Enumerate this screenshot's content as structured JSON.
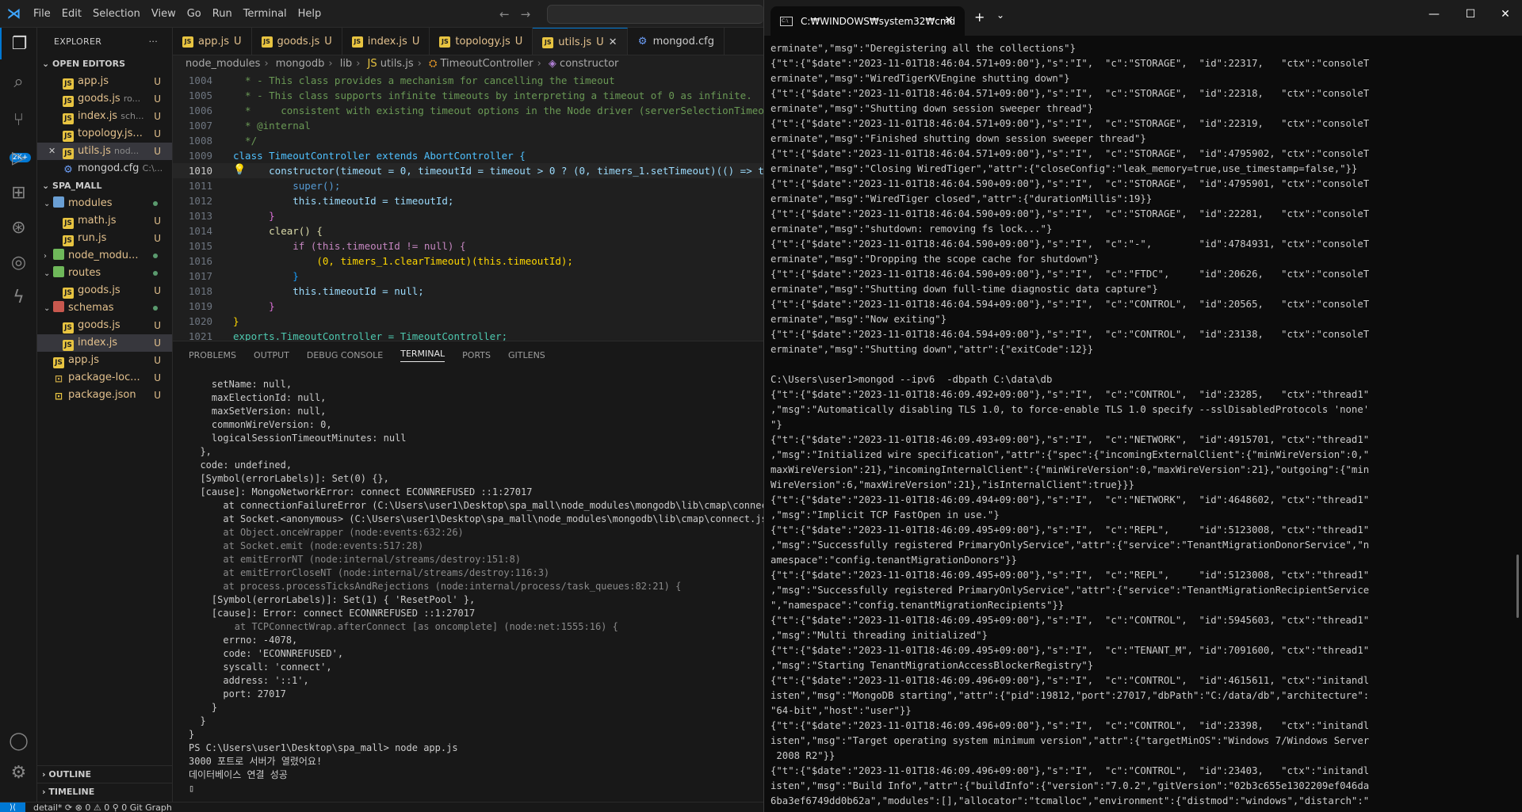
{
  "menu": [
    "File",
    "Edit",
    "Selection",
    "View",
    "Go",
    "Run",
    "Terminal",
    "Help"
  ],
  "activity_badge": "2K+",
  "explorer": {
    "title": "EXPLORER",
    "open_editors_label": "OPEN EDITORS",
    "open_editors": [
      {
        "name": "app.js",
        "desc": "",
        "badge": "U"
      },
      {
        "name": "goods.js",
        "desc": "ro...",
        "badge": "U"
      },
      {
        "name": "index.js",
        "desc": "sch...",
        "badge": "U"
      },
      {
        "name": "topology.js...",
        "desc": "",
        "badge": "U"
      },
      {
        "name": "utils.js",
        "desc": "nod...",
        "badge": "U"
      },
      {
        "name": "mongod.cfg",
        "desc": "C:\\...",
        "badge": ""
      }
    ],
    "project_label": "SPA_MALL",
    "tree": [
      {
        "name": "modules"
      },
      {
        "name": "math.js",
        "badge": "U"
      },
      {
        "name": "run.js",
        "badge": "U"
      },
      {
        "name": "node_modu..."
      },
      {
        "name": "routes"
      },
      {
        "name": "goods.js",
        "badge": "U"
      },
      {
        "name": "schemas"
      },
      {
        "name": "goods.js",
        "badge": "U"
      },
      {
        "name": "index.js",
        "badge": "U"
      },
      {
        "name": "app.js",
        "badge": "U"
      },
      {
        "name": "package-loc...",
        "badge": "U"
      },
      {
        "name": "package.json",
        "badge": "U"
      }
    ],
    "outline_label": "OUTLINE",
    "timeline_label": "TIMELINE"
  },
  "tabs": [
    {
      "name": "app.js",
      "badge": "U"
    },
    {
      "name": "goods.js",
      "badge": "U"
    },
    {
      "name": "index.js",
      "badge": "U"
    },
    {
      "name": "topology.js",
      "badge": "U"
    },
    {
      "name": "utils.js",
      "badge": "U"
    },
    {
      "name": "mongod.cfg",
      "badge": ""
    }
  ],
  "breadcrumb": [
    "node_modules",
    "mongodb",
    "lib",
    "utils.js",
    "TimeoutController",
    "constructor"
  ],
  "code_lines": [
    {
      "n": "1004",
      "t": "  * - This class provides a mechanism for cancelling the timeout"
    },
    {
      "n": "1005",
      "t": "  * - This class supports infinite timeouts by interpreting a timeout of 0 as infinite."
    },
    {
      "n": "1006",
      "t": "  *     consistent with existing timeout options in the Node driver (serverSelectionTimeo"
    },
    {
      "n": "1007",
      "t": "  * @internal"
    },
    {
      "n": "1008",
      "t": "  */"
    },
    {
      "n": "1009",
      "t": "class TimeoutController extends AbortController {"
    },
    {
      "n": "1010",
      "t": "      constructor(timeout = 0, timeoutId = timeout > 0 ? (0, timers_1.setTimeout)(() => t"
    },
    {
      "n": "1011",
      "t": "          super();"
    },
    {
      "n": "1012",
      "t": "          this.timeoutId = timeoutId;"
    },
    {
      "n": "1013",
      "t": "      }"
    },
    {
      "n": "1014",
      "t": "      clear() {"
    },
    {
      "n": "1015",
      "t": "          if (this.timeoutId != null) {"
    },
    {
      "n": "1016",
      "t": "              (0, timers_1.clearTimeout)(this.timeoutId);"
    },
    {
      "n": "1017",
      "t": "          }"
    },
    {
      "n": "1018",
      "t": "          this.timeoutId = null;"
    },
    {
      "n": "1019",
      "t": "      }"
    },
    {
      "n": "1020",
      "t": "}"
    },
    {
      "n": "1021",
      "t": "exports.TimeoutController = TimeoutController;"
    }
  ],
  "panel_tabs": [
    "PROBLEMS",
    "OUTPUT",
    "DEBUG CONSOLE",
    "TERMINAL",
    "PORTS",
    "GITLENS"
  ],
  "terminal_lines": [
    "    setName: null,",
    "    maxElectionId: null,",
    "    maxSetVersion: null,",
    "    commonWireVersion: 0,",
    "    logicalSessionTimeoutMinutes: null",
    "  },",
    "  code: undefined,",
    "  [Symbol(errorLabels)]: Set(0) {},",
    "  [cause]: MongoNetworkError: connect ECONNREFUSED ::1:27017",
    "      at connectionFailureError (C:\\Users\\user1\\Desktop\\spa_mall\\node_modules\\mongodb\\lib\\cmap\\connect.",
    "      at Socket.<anonymous> (C:\\Users\\user1\\Desktop\\spa_mall\\node_modules\\mongodb\\lib\\cmap\\connect.js:2",
    "      at Object.onceWrapper (node:events:632:26)",
    "      at Socket.emit (node:events:517:28)",
    "      at emitErrorNT (node:internal/streams/destroy:151:8)",
    "      at emitErrorCloseNT (node:internal/streams/destroy:116:3)",
    "      at process.processTicksAndRejections (node:internal/process/task_queues:82:21) {",
    "    [Symbol(errorLabels)]: Set(1) { 'ResetPool' },",
    "    [cause]: Error: connect ECONNREFUSED ::1:27017",
    "        at TCPConnectWrap.afterConnect [as oncomplete] (node:net:1555:16) {",
    "      errno: -4078,",
    "      code: 'ECONNREFUSED',",
    "      syscall: 'connect',",
    "      address: '::1',",
    "      port: 27017",
    "    }",
    "  }",
    "}",
    "PS C:\\Users\\user1\\Desktop\\spa_mall> node app.js",
    "3000 포트로 서버가 열렸어요!",
    "데이터베이스 연결 성공",
    "▯"
  ],
  "status_text": "detail*  ⟳   ⊗ 0 ⚠ 0   ⚲ 0    Git Graph",
  "cmd": {
    "tab_title": "C:₩WINDOWS₩system32₩cmd",
    "lines": [
      "erminate\",\"msg\":\"Deregistering all the collections\"}",
      "{\"t\":{\"$date\":\"2023-11-01T18:46:04.571+09:00\"},\"s\":\"I\",  \"c\":\"STORAGE\",  \"id\":22317,   \"ctx\":\"consoleT",
      "erminate\",\"msg\":\"WiredTigerKVEngine shutting down\"}",
      "{\"t\":{\"$date\":\"2023-11-01T18:46:04.571+09:00\"},\"s\":\"I\",  \"c\":\"STORAGE\",  \"id\":22318,   \"ctx\":\"consoleT",
      "erminate\",\"msg\":\"Shutting down session sweeper thread\"}",
      "{\"t\":{\"$date\":\"2023-11-01T18:46:04.571+09:00\"},\"s\":\"I\",  \"c\":\"STORAGE\",  \"id\":22319,   \"ctx\":\"consoleT",
      "erminate\",\"msg\":\"Finished shutting down session sweeper thread\"}",
      "{\"t\":{\"$date\":\"2023-11-01T18:46:04.571+09:00\"},\"s\":\"I\",  \"c\":\"STORAGE\",  \"id\":4795902, \"ctx\":\"consoleT",
      "erminate\",\"msg\":\"Closing WiredTiger\",\"attr\":{\"closeConfig\":\"leak_memory=true,use_timestamp=false,\"}}",
      "{\"t\":{\"$date\":\"2023-11-01T18:46:04.590+09:00\"},\"s\":\"I\",  \"c\":\"STORAGE\",  \"id\":4795901, \"ctx\":\"consoleT",
      "erminate\",\"msg\":\"WiredTiger closed\",\"attr\":{\"durationMillis\":19}}",
      "{\"t\":{\"$date\":\"2023-11-01T18:46:04.590+09:00\"},\"s\":\"I\",  \"c\":\"STORAGE\",  \"id\":22281,   \"ctx\":\"consoleT",
      "erminate\",\"msg\":\"shutdown: removing fs lock...\"}",
      "{\"t\":{\"$date\":\"2023-11-01T18:46:04.590+09:00\"},\"s\":\"I\",  \"c\":\"-\",        \"id\":4784931, \"ctx\":\"consoleT",
      "erminate\",\"msg\":\"Dropping the scope cache for shutdown\"}",
      "{\"t\":{\"$date\":\"2023-11-01T18:46:04.590+09:00\"},\"s\":\"I\",  \"c\":\"FTDC\",     \"id\":20626,   \"ctx\":\"consoleT",
      "erminate\",\"msg\":\"Shutting down full-time diagnostic data capture\"}",
      "{\"t\":{\"$date\":\"2023-11-01T18:46:04.594+09:00\"},\"s\":\"I\",  \"c\":\"CONTROL\",  \"id\":20565,   \"ctx\":\"consoleT",
      "erminate\",\"msg\":\"Now exiting\"}",
      "{\"t\":{\"$date\":\"2023-11-01T18:46:04.594+09:00\"},\"s\":\"I\",  \"c\":\"CONTROL\",  \"id\":23138,   \"ctx\":\"consoleT",
      "erminate\",\"msg\":\"Shutting down\",\"attr\":{\"exitCode\":12}}",
      "",
      "C:\\Users\\user1>mongod --ipv6  -dbpath C:\\data\\db",
      "{\"t\":{\"$date\":\"2023-11-01T18:46:09.492+09:00\"},\"s\":\"I\",  \"c\":\"CONTROL\",  \"id\":23285,   \"ctx\":\"thread1\"",
      ",\"msg\":\"Automatically disabling TLS 1.0, to force-enable TLS 1.0 specify --sslDisabledProtocols 'none'",
      "\"}",
      "{\"t\":{\"$date\":\"2023-11-01T18:46:09.493+09:00\"},\"s\":\"I\",  \"c\":\"NETWORK\",  \"id\":4915701, \"ctx\":\"thread1\"",
      ",\"msg\":\"Initialized wire specification\",\"attr\":{\"spec\":{\"incomingExternalClient\":{\"minWireVersion\":0,\"",
      "maxWireVersion\":21},\"incomingInternalClient\":{\"minWireVersion\":0,\"maxWireVersion\":21},\"outgoing\":{\"min",
      "WireVersion\":6,\"maxWireVersion\":21},\"isInternalClient\":true}}}",
      "{\"t\":{\"$date\":\"2023-11-01T18:46:09.494+09:00\"},\"s\":\"I\",  \"c\":\"NETWORK\",  \"id\":4648602, \"ctx\":\"thread1\"",
      ",\"msg\":\"Implicit TCP FastOpen in use.\"}",
      "{\"t\":{\"$date\":\"2023-11-01T18:46:09.495+09:00\"},\"s\":\"I\",  \"c\":\"REPL\",     \"id\":5123008, \"ctx\":\"thread1\"",
      ",\"msg\":\"Successfully registered PrimaryOnlyService\",\"attr\":{\"service\":\"TenantMigrationDonorService\",\"n",
      "amespace\":\"config.tenantMigrationDonors\"}}",
      "{\"t\":{\"$date\":\"2023-11-01T18:46:09.495+09:00\"},\"s\":\"I\",  \"c\":\"REPL\",     \"id\":5123008, \"ctx\":\"thread1\"",
      ",\"msg\":\"Successfully registered PrimaryOnlyService\",\"attr\":{\"service\":\"TenantMigrationRecipientService",
      "\",\"namespace\":\"config.tenantMigrationRecipients\"}}",
      "{\"t\":{\"$date\":\"2023-11-01T18:46:09.495+09:00\"},\"s\":\"I\",  \"c\":\"CONTROL\",  \"id\":5945603, \"ctx\":\"thread1\"",
      ",\"msg\":\"Multi threading initialized\"}",
      "{\"t\":{\"$date\":\"2023-11-01T18:46:09.495+09:00\"},\"s\":\"I\",  \"c\":\"TENANT_M\", \"id\":7091600, \"ctx\":\"thread1\"",
      ",\"msg\":\"Starting TenantMigrationAccessBlockerRegistry\"}",
      "{\"t\":{\"$date\":\"2023-11-01T18:46:09.496+09:00\"},\"s\":\"I\",  \"c\":\"CONTROL\",  \"id\":4615611, \"ctx\":\"initandl",
      "isten\",\"msg\":\"MongoDB starting\",\"attr\":{\"pid\":19812,\"port\":27017,\"dbPath\":\"C:/data/db\",\"architecture\":",
      "\"64-bit\",\"host\":\"user\"}}",
      "{\"t\":{\"$date\":\"2023-11-01T18:46:09.496+09:00\"},\"s\":\"I\",  \"c\":\"CONTROL\",  \"id\":23398,   \"ctx\":\"initandl",
      "isten\",\"msg\":\"Target operating system minimum version\",\"attr\":{\"targetMinOS\":\"Windows 7/Windows Server",
      " 2008 R2\"}}",
      "{\"t\":{\"$date\":\"2023-11-01T18:46:09.496+09:00\"},\"s\":\"I\",  \"c\":\"CONTROL\",  \"id\":23403,   \"ctx\":\"initandl",
      "isten\",\"msg\":\"Build Info\",\"attr\":{\"buildInfo\":{\"version\":\"7.0.2\",\"gitVersion\":\"02b3c655e1302209ef046da",
      "6ba3ef6749dd0b62a\",\"modules\":[],\"allocator\":\"tcmalloc\",\"environment\":{\"distmod\":\"windows\",\"distarch\":\""
    ]
  }
}
